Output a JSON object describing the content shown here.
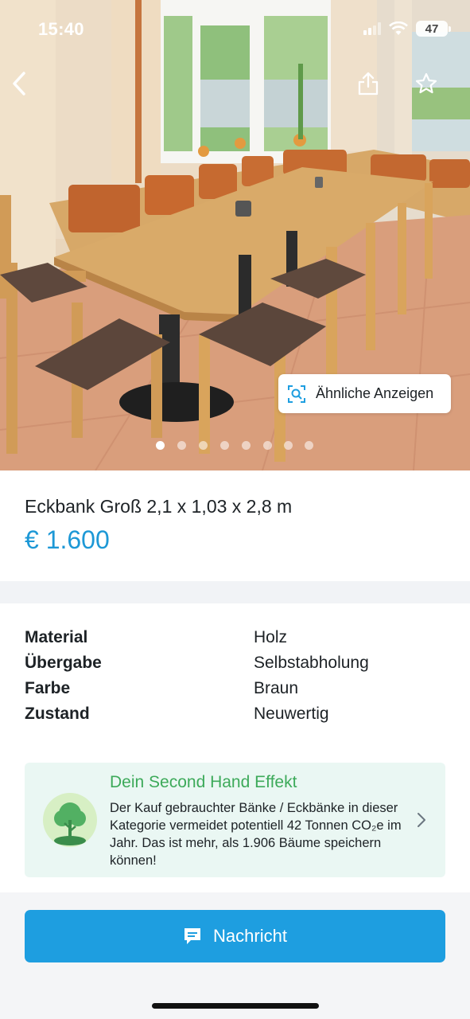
{
  "status_bar": {
    "time": "15:40",
    "battery": "47",
    "icons": [
      "signal-icon",
      "wifi-icon",
      "battery-icon"
    ]
  },
  "gallery": {
    "image_count": 8,
    "active_index": 0,
    "similar_label": "Ähnliche Anzeigen",
    "icons": [
      "back-chevron-icon",
      "share-icon",
      "star-icon",
      "visual-search-icon"
    ]
  },
  "listing": {
    "title": "Eckbank Groß 2,1 x 1,03 x 2,8 m",
    "price": "€ 1.600"
  },
  "attributes": [
    {
      "key": "Material",
      "value": "Holz"
    },
    {
      "key": "Übergabe",
      "value": "Selbstabholung"
    },
    {
      "key": "Farbe",
      "value": "Braun"
    },
    {
      "key": "Zustand",
      "value": "Neuwertig"
    }
  ],
  "eco": {
    "title": "Dein Second Hand Effekt",
    "text": "Der Kauf gebrauchter Bänke / Eckbänke in dieser Kategorie vermeidet potentiell 42 Tonnen CO₂e im Jahr. Das ist mehr, als 1.906 Bäume speichern können!",
    "icon": "tree-icon"
  },
  "actions": {
    "message_label": "Nachricht",
    "message_icon": "chat-bubble-icon"
  },
  "colors": {
    "accent": "#1e9ee0",
    "price": "#1d98d6",
    "eco_green": "#3daa5a",
    "eco_bg": "#eaf7f3"
  }
}
